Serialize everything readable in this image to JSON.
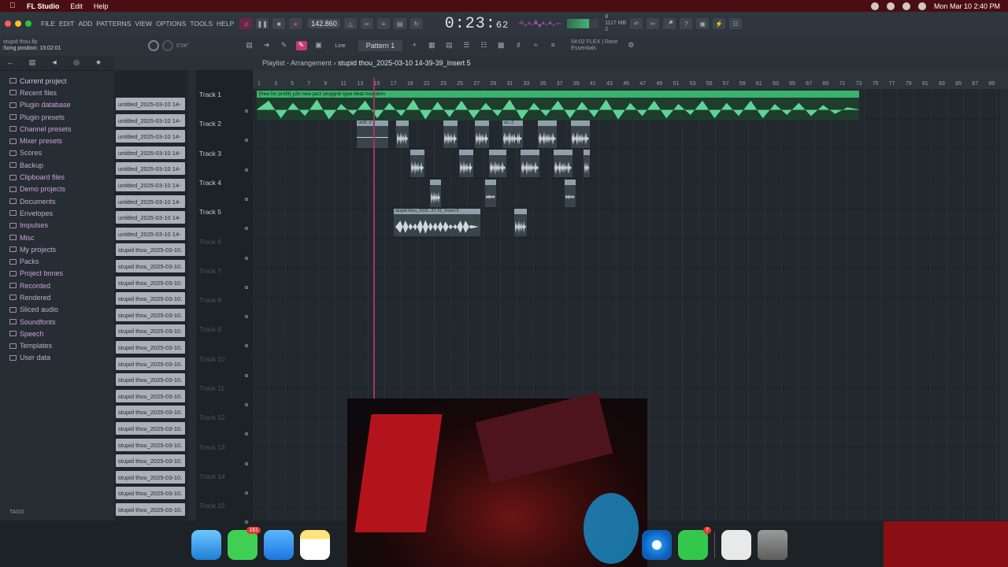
{
  "mac_menu": {
    "app_name": "FL Studio",
    "items": [
      "Edit",
      "Help"
    ],
    "clock": "Mon Mar 10  2:40 PM"
  },
  "toolbar": {
    "menus": [
      "FILE",
      "EDIT",
      "ADD",
      "PATTERNS",
      "VIEW",
      "OPTIONS",
      "TOOLS",
      "HELP"
    ],
    "tempo": "142.860",
    "time_main": "0:23",
    "time_sub": "62",
    "cpu_line1": "8",
    "cpu_line2": "1117 MB",
    "cpu_line3": "2"
  },
  "subbar": {
    "song_file": "stupid thou.flp",
    "song_position": "Song position: 15:02:01",
    "knob_value": "0'24\"",
    "snap": "Line",
    "pattern": "Pattern 1",
    "news_line1": "04:02  FLEX  |  Rave",
    "news_line2": "Essentials"
  },
  "playlist": {
    "title_prefix": "Playlist - Arrangement",
    "title_path": "stupid thou_2025-03-10 14-39-39_Insert 5",
    "ruler": [
      "1",
      "3",
      "5",
      "7",
      "9",
      "11",
      "13",
      "15",
      "17",
      "19",
      "21",
      "23",
      "25",
      "27",
      "29",
      "31",
      "33",
      "35",
      "37",
      "39",
      "41",
      "43",
      "45",
      "47",
      "49",
      "51",
      "53",
      "55",
      "57",
      "59",
      "61",
      "63",
      "65",
      "67",
      "69",
      "71",
      "73",
      "75",
      "77",
      "79",
      "81",
      "83",
      "85",
      "87",
      "89"
    ],
    "tracks": [
      "Track 1",
      "Track 2",
      "Track 3",
      "Track 4",
      "Track 5",
      "Track 6",
      "Track 7",
      "Track 8",
      "Track 9",
      "Track 10",
      "Track 11",
      "Track 12",
      "Track 13",
      "Track 14",
      "Track 15"
    ],
    "main_clip_label": "[free for profit] y2k  new jazz  pluggnb type beat mandem",
    "clip_labels": {
      "t2a": "untit..rt 2",
      "t2b": "un..2",
      "t5a": "stupid thou_2025..37-21_Insert 5"
    }
  },
  "browser": {
    "items": [
      "Current project",
      "Recent files",
      "Plugin database",
      "Plugin presets",
      "Channel presets",
      "Mixer presets",
      "Scores",
      "Backup",
      "Clipboard files",
      "Demo projects",
      "Documents",
      "Envelopes",
      "Impulses",
      "Misc",
      "My projects",
      "Packs",
      "Project bones",
      "Recorded",
      "Rendered",
      "Sliced audio",
      "Soundfonts",
      "Speech",
      "Templates",
      "User data"
    ],
    "tags_label": "TAGS"
  },
  "files": [
    "untitled_2025-03-10 14-",
    "untitled_2025-03-10 14-",
    "untitled_2025-03-10 14-",
    "untitled_2025-03-10 14-",
    "untitled_2025-03-10 14-",
    "untitled_2025-03-10 14-",
    "untitled_2025-03-10 14-",
    "untitled_2025-03-10 14-",
    "untitled_2025-03-10 14-",
    "stupid thou_2025-03-10.",
    "stupid thou_2025-03-10.",
    "stupid thou_2025-03-10.",
    "stupid thou_2025-03-10.",
    "stupid thou_2025-03-10.",
    "stupid thou_2025-03-10.",
    "stupid thou_2025-03-10.",
    "stupid thou_2025-03-10.",
    "stupid thou_2025-03-10.",
    "stupid thou_2025-03-10.",
    "stupid thou_2025-03-10.",
    "stupid thou_2025-03-10.",
    "stupid thou_2025-03-10.",
    "stupid thou_2025-03-10.",
    "stupid thou_2025-03-10.",
    "stupid thou_2025-03-10.",
    "stupid thou_2025-03-10."
  ],
  "dock": {
    "messages_badge": "161",
    "facetime_badge": "7"
  }
}
